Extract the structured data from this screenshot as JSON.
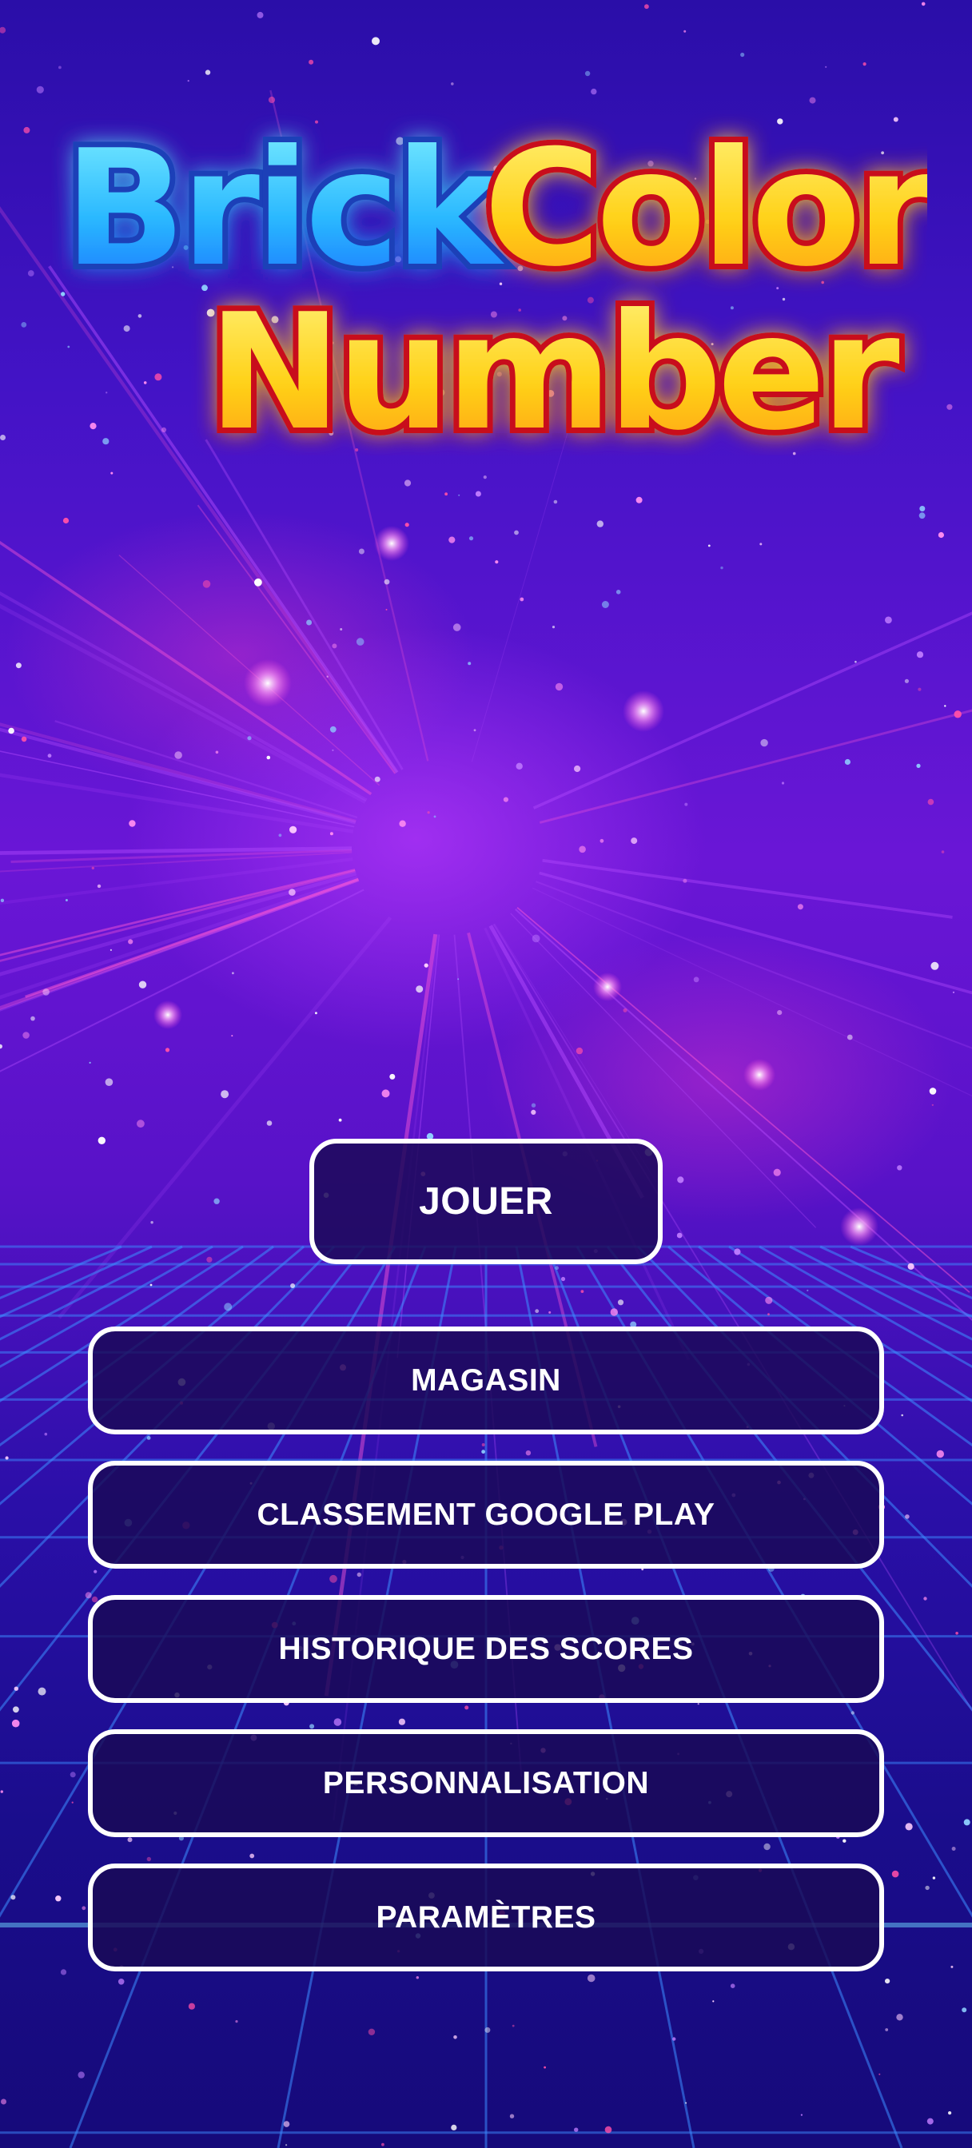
{
  "logo": {
    "word1": "Brick",
    "word2": "Color",
    "word3": "Number"
  },
  "menu": {
    "play_label": "JOUER",
    "items": [
      {
        "label": "MAGASIN"
      },
      {
        "label": "CLASSEMENT GOOGLE PLAY"
      },
      {
        "label": "HISTORIQUE DES SCORES"
      },
      {
        "label": "PERSONNALISATION"
      },
      {
        "label": "PARAMÈTRES"
      }
    ]
  },
  "colors": {
    "background_top": "#2a0ea8",
    "background_mid": "#6a16d6",
    "background_bottom": "#160a7a",
    "grid_line": "#3c8cff",
    "button_fill": "#1a0a54",
    "button_border": "#ffffff",
    "button_text": "#ffffff",
    "logo_blue": "#2ab8ff",
    "logo_yellow": "#ffd21a",
    "logo_red": "#c8101e"
  }
}
